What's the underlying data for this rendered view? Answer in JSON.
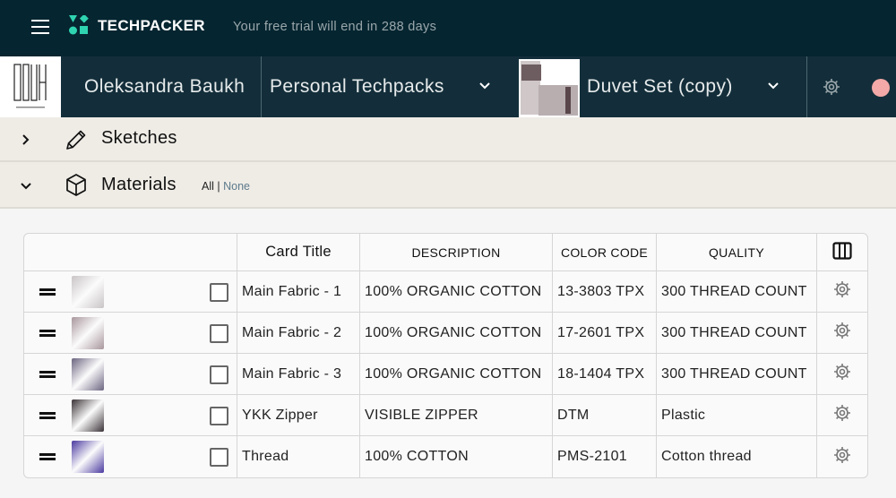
{
  "topbar": {
    "brand": "TECHPACKER",
    "trial_prefix": "Your free trial will end in",
    "trial_days": "288",
    "trial_suffix": "days",
    "accent": "#2fd3b0"
  },
  "context": {
    "logo_text": "BAUH",
    "user": "Oleksandra Baukh",
    "workspace": "Personal Techpacks",
    "techpack": "Duvet Set (copy)",
    "avatar_color": "#f2a9a7"
  },
  "sections": {
    "sketches": "Sketches",
    "materials": "Materials",
    "select_all": "All",
    "select_sep": "|",
    "select_none": "None"
  },
  "table": {
    "headers": [
      "Card Title",
      "DESCRIPTION",
      "COLOR CODE",
      "QUALITY"
    ],
    "rows": [
      {
        "title": "Main Fabric  - 1",
        "description": "100% ORGANIC COTTON",
        "color_code": "13-3803 TPX",
        "quality": "300 THREAD COUNT",
        "swatch": "#c9c4c6"
      },
      {
        "title": "Main Fabric - 2",
        "description": "100% ORGANIC COTTON",
        "color_code": "17-2601 TPX",
        "quality": "300 THREAD COUNT",
        "swatch": "#a8969c"
      },
      {
        "title": "Main Fabric - 3",
        "description": "100% ORGANIC COTTON",
        "color_code": "18-1404 TPX",
        "quality": "300 THREAD COUNT",
        "swatch": "#6c6480"
      },
      {
        "title": "YKK Zipper",
        "description": "VISIBLE ZIPPER",
        "color_code": "DTM",
        "quality": "Plastic",
        "swatch": "#3a3236"
      },
      {
        "title": "Thread",
        "description": "100% COTTON",
        "color_code": "PMS-2101",
        "quality": "Cotton thread",
        "swatch": "#4a3aa0"
      }
    ]
  }
}
